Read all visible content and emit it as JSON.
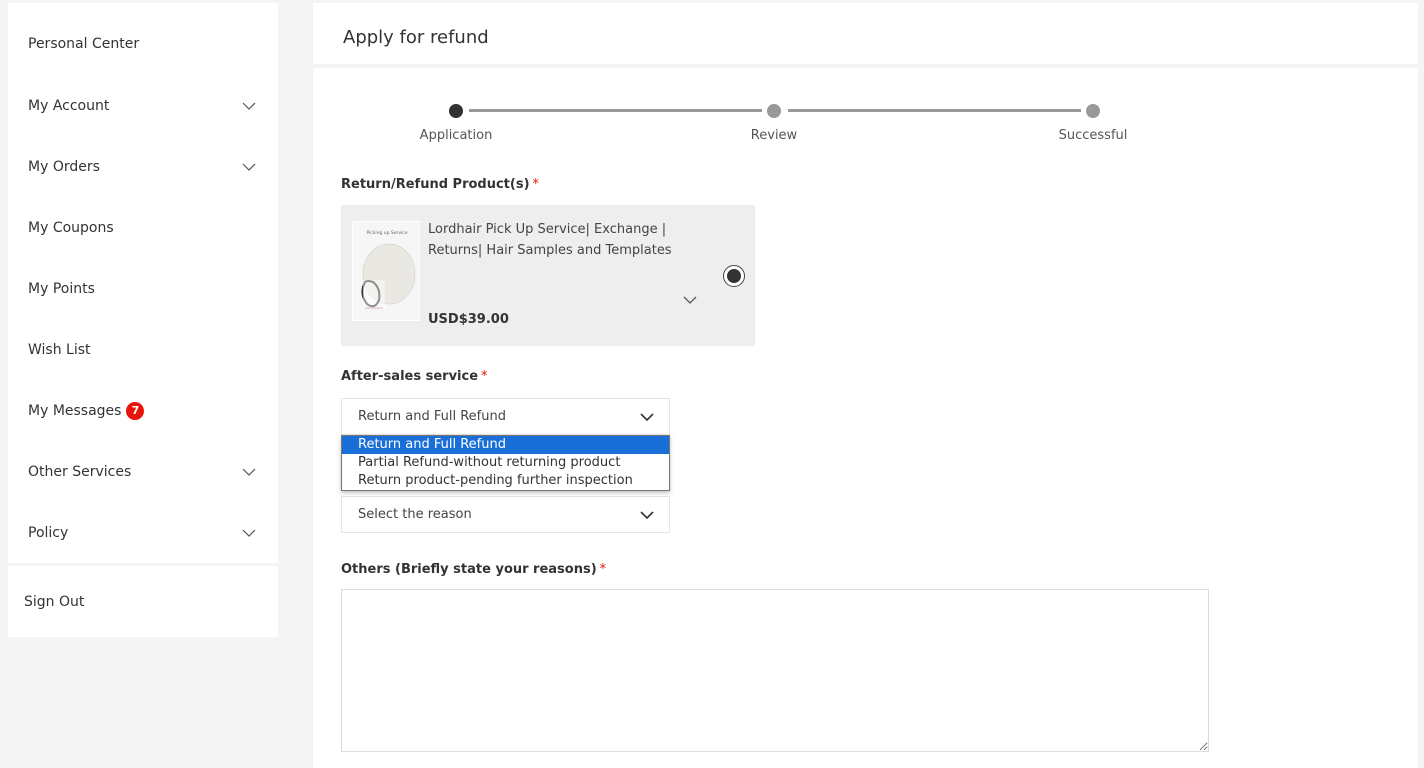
{
  "sidebar": {
    "items": [
      {
        "label": "Personal Center",
        "has_chevron": false
      },
      {
        "label": "My Account",
        "has_chevron": true
      },
      {
        "label": "My Orders",
        "has_chevron": true
      },
      {
        "label": "My Coupons",
        "has_chevron": false
      },
      {
        "label": "My Points",
        "has_chevron": false
      },
      {
        "label": "Wish List",
        "has_chevron": false
      },
      {
        "label": "My Messages",
        "has_chevron": false,
        "badge": "7"
      },
      {
        "label": "Other Services",
        "has_chevron": true
      },
      {
        "label": "Policy",
        "has_chevron": true
      }
    ],
    "sign_out": "Sign Out"
  },
  "page": {
    "title": "Apply for refund",
    "steps": [
      {
        "label": "Application",
        "active": true
      },
      {
        "label": "Review",
        "active": false
      },
      {
        "label": "Successful",
        "active": false
      }
    ]
  },
  "form": {
    "products_label": "Return/Refund Product(s)",
    "required_mark": "*",
    "product": {
      "image_caption": "Picking up Service",
      "name": "Lordhair Pick Up Service| Exchange | Returns| Hair Samples and Templates",
      "price": "USD$39.00",
      "selected": true
    },
    "service_label": "After-sales service",
    "service_value": "Return and Full Refund",
    "service_options": [
      "Return and Full Refund",
      "Partial Refund-without returning product",
      "Return product-pending further inspection"
    ],
    "reason_placeholder": "Select the reason",
    "others_label": "Others (Briefly state your reasons)",
    "others_value": ""
  },
  "colors": {
    "accent_red": "#e8140b",
    "selected_option": "#1a6ed8",
    "active_step": "#333333",
    "inactive_step": "#999999"
  }
}
